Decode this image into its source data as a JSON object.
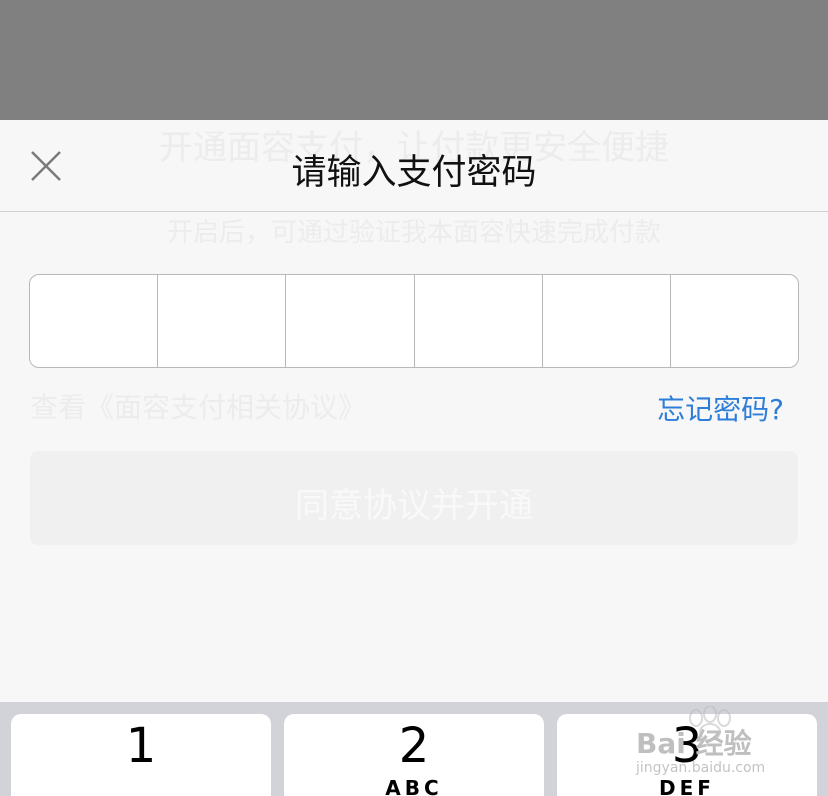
{
  "background": {
    "title": "开通面容支付，让付款更安全便捷",
    "subtitle": "开启后，可通过验证我本面容快速完成付款",
    "agreement_link": "查看《面容支付相关协议》",
    "agree_button_label": "同意协议并开通",
    "face_icon": "face-id-frame-icon"
  },
  "dialog": {
    "title": "请输入支付密码",
    "close_icon": "close-icon",
    "pin_length": 6,
    "forgot_label": "忘记密码?"
  },
  "keyboard": {
    "keys": [
      {
        "number": "1",
        "letters": ""
      },
      {
        "number": "2",
        "letters": "ABC"
      },
      {
        "number": "3",
        "letters": "DEF"
      }
    ]
  },
  "watermark": {
    "brand": "Bai 经验",
    "url": "jingyan.baidu.com"
  },
  "colors": {
    "overlay": "#808080",
    "accent": "#2d7ed9",
    "sheet": "#f7f7f7",
    "keyboard": "#d1d3d9"
  }
}
